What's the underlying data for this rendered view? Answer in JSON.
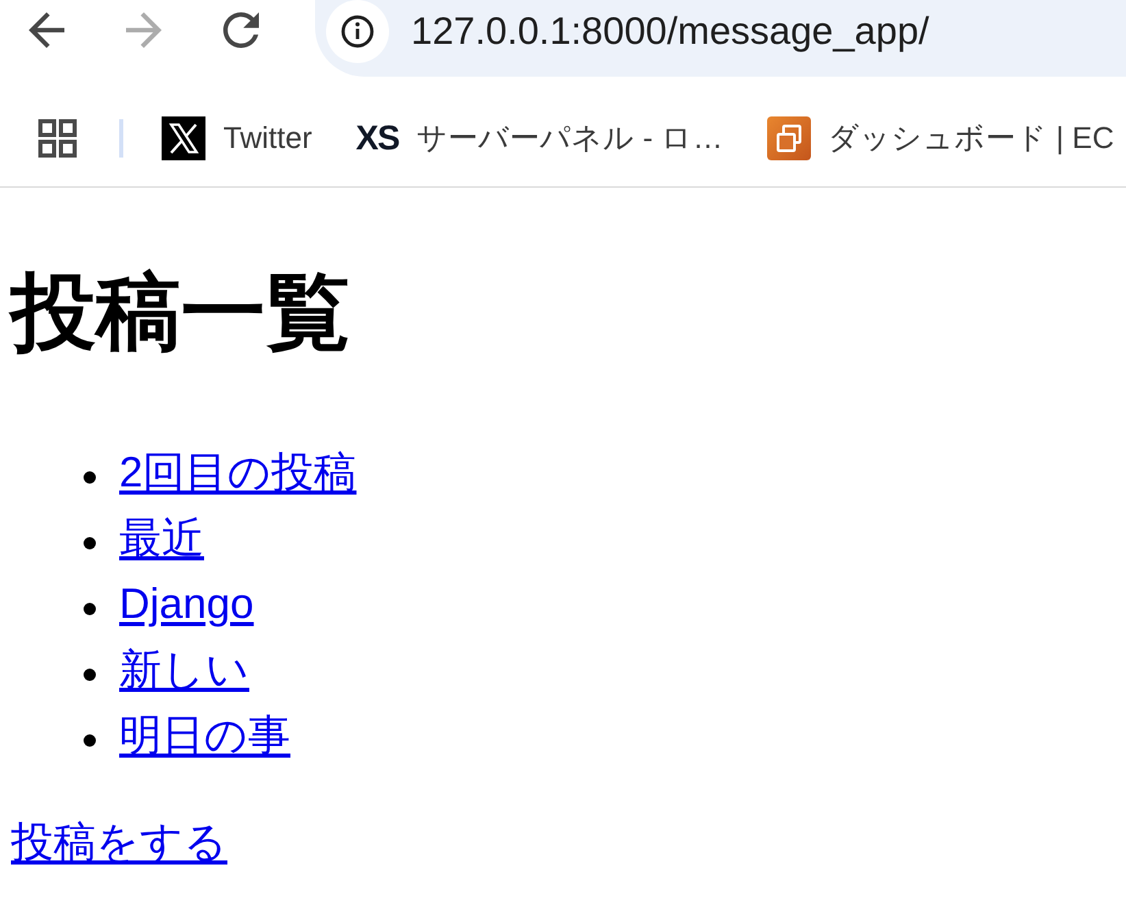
{
  "toolbar": {
    "nav": [
      {
        "kind": "back",
        "disabled": false
      },
      {
        "kind": "forward",
        "disabled": true
      },
      {
        "kind": "reload",
        "disabled": false
      }
    ],
    "address": "127.0.0.1:8000/message_app/"
  },
  "bookmarks": [
    {
      "kind": "x",
      "label": "Twitter"
    },
    {
      "kind": "xs",
      "logo_text": "XS",
      "label": "サーバーパネル - ロ…"
    },
    {
      "kind": "tile",
      "label": "ダッシュボード | EC"
    }
  ],
  "page": {
    "heading": "投稿一覧",
    "posts": [
      "2回目の投稿",
      "最近",
      "Django",
      "新しい",
      "明日の事"
    ],
    "new_post_link": "投稿をする"
  }
}
